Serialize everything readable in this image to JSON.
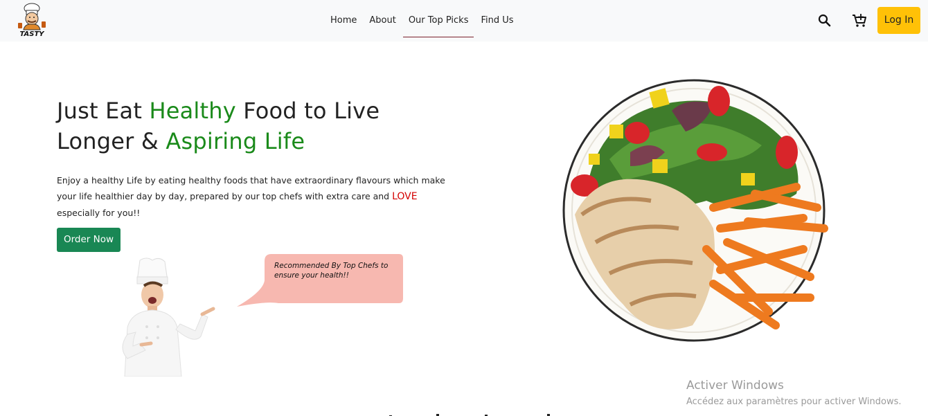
{
  "navbar": {
    "brand_alt": "TASTY",
    "links": [
      {
        "label": "Home",
        "active": false
      },
      {
        "label": "About",
        "active": false
      },
      {
        "label": "Our Top Picks",
        "active": true
      },
      {
        "label": "Find Us",
        "active": false
      }
    ],
    "search_icon": "search-icon",
    "cart_icon": "cart-icon",
    "login_label": "Log In"
  },
  "hero": {
    "title_part1": "Just Eat ",
    "title_green1": "Healthy",
    "title_part2": " Food to Live Longer & ",
    "title_green2": "Aspiring Life",
    "desc_part1": "Enjoy a healthy Life by eating healthy foods that have extraordinary flavours which make your life healthier day by day, prepared by our top chefs with extra care and ",
    "desc_love": "LOVE",
    "desc_part2": " especially for you!!",
    "order_label": "Order Now",
    "speech_text": "Recommended By Top Chefs to ensure your health!!"
  },
  "colors": {
    "accent_green": "#1a8a1a",
    "button_green": "#198754",
    "login_yellow": "#ffc107",
    "love_red": "#d40000",
    "speech_bg": "#f7b8b0"
  },
  "watermark": {
    "title": "Activer Windows",
    "subtitle": "Accédez aux paramètres pour activer Windows."
  }
}
